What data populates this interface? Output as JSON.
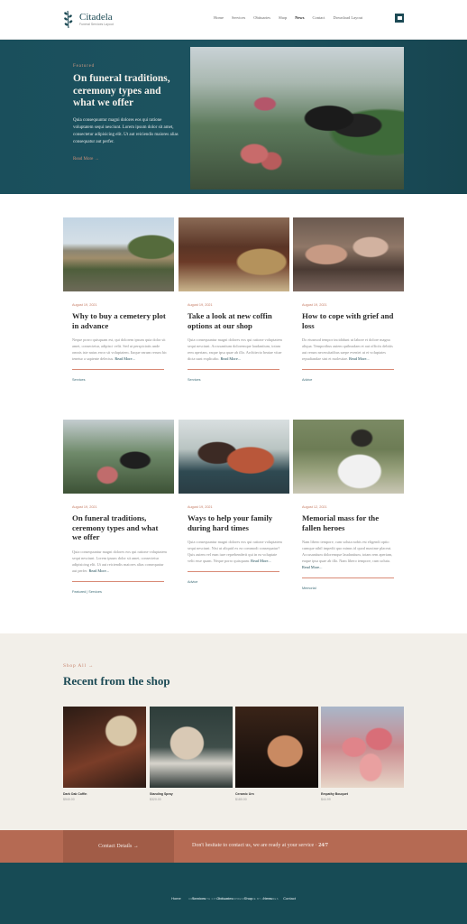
{
  "header": {
    "brand": "Citadela",
    "tagline": "Funeral Services Layout",
    "nav": [
      {
        "label": "Home",
        "active": false
      },
      {
        "label": "Services",
        "active": false
      },
      {
        "label": "Obituaries",
        "active": false
      },
      {
        "label": "Shop",
        "active": false
      },
      {
        "label": "News",
        "active": true
      },
      {
        "label": "Contact",
        "active": false
      },
      {
        "label": "Download Layout",
        "active": false
      }
    ],
    "cart_icon": "briefcase-icon"
  },
  "hero": {
    "kicker": "Featured",
    "title": "On funeral traditions, ceremony types and what we offer",
    "body": "Quia consequuntur magni dolores eos qui ratione voluptatem sequi nesciunt. Lorem ipsum dolor sit amet, consectetur adipisicing elit. Ut aut reiciendis maiores alias consequatur aut perfer.",
    "read_more": "Read More →"
  },
  "posts": [
    {
      "date": "August 19, 2021",
      "title": "Why to buy a cemetery plot in advance",
      "excerpt": "Neque porro quisquam est, qui dolorem ipsum quia dolor sit amet, consectetur, adipisci velit. Sed ut perspiciatis unde omnis iste natus error sit voluptatem. Itaque earum rerum hic tenetur a sapiente delectus.",
      "read_more": "Read More...",
      "category": "Services"
    },
    {
      "date": "August 19, 2021",
      "title": "Take a look at new coffin options at our shop",
      "excerpt": "Quia consequuntur magni dolores eos qui ratione voluptatem sequi nesciunt. Accusantium doloremque laudantium, totam rem aperiam, eaque ipsa quae ab illo. Architecto beatae vitae dicta sunt explicabo.",
      "read_more": "Read More...",
      "category": "Services"
    },
    {
      "date": "August 19, 2021",
      "title": "How to cope with grief and loss",
      "excerpt": "Do eiusmod tempor incididunt ut labore et dolore magna aliqua. Temporibus autem quibusdam et aut officiis debitis aut rerum necessitatibus saepe eveniet ut et voluptates repudiandae sint et molestiae.",
      "read_more": "Read More...",
      "category": "Advice"
    },
    {
      "date": "August 19, 2021",
      "title": "On funeral traditions, ceremony types and what we offer",
      "excerpt": "Quia consequuntur magni dolores eos qui ratione voluptatem sequi nesciunt. Lorem ipsum dolor sit amet, consectetur adipisicing elit. Ut aut reiciendis maiores alias consequatur aut perfer.",
      "read_more": "Read More...",
      "category": "Featured | Services"
    },
    {
      "date": "August 19, 2021",
      "title": "Ways to help your family during hard times",
      "excerpt": "Quia consequuntur magni dolores eos qui ratione voluptatem sequi nesciunt. Nisi ut aliquid ex ea commodi consequatur? Quis autem vel eum iure reprehenderit qui in ea voluptate velit esse quam. Neque porro quisquam.",
      "read_more": "Read More...",
      "category": "Advice"
    },
    {
      "date": "August 12, 2021",
      "title": "Memorial mass for the fallen heroes",
      "excerpt": "Nam libero tempore, cum soluta nobis est eligendi optio cumque nihil impedit quo minus id quod maxime placeat. Accusantium doloremque laudantium, totam rem aperiam, eaque ipsa quae ab illo. Nam libero tempore, cum soluta.",
      "read_more": "Read More...",
      "category": "Memorial"
    }
  ],
  "shop": {
    "kicker": "Shop All →",
    "title": "Recent from the shop",
    "products": [
      {
        "name": "Dark Oak Coffin",
        "price": "$540.00"
      },
      {
        "name": "Standing Spray",
        "price": "$320.00"
      },
      {
        "name": "Ceramic Urn",
        "price": "$180.00"
      },
      {
        "name": "Empathy Bouquet",
        "price": "$44.99"
      }
    ]
  },
  "cta": {
    "button": "Contact Details →",
    "text": "Don't hesitate to contact us, we are ready at your service · ",
    "highlight": "24/7"
  },
  "footer": {
    "nav": [
      "Home",
      "Services",
      "Obituaries",
      "Shop",
      "News",
      "Contact"
    ],
    "credit": "CREATED WITH CITADELA WORDPRESS THEME BY AITTHEMES"
  }
}
